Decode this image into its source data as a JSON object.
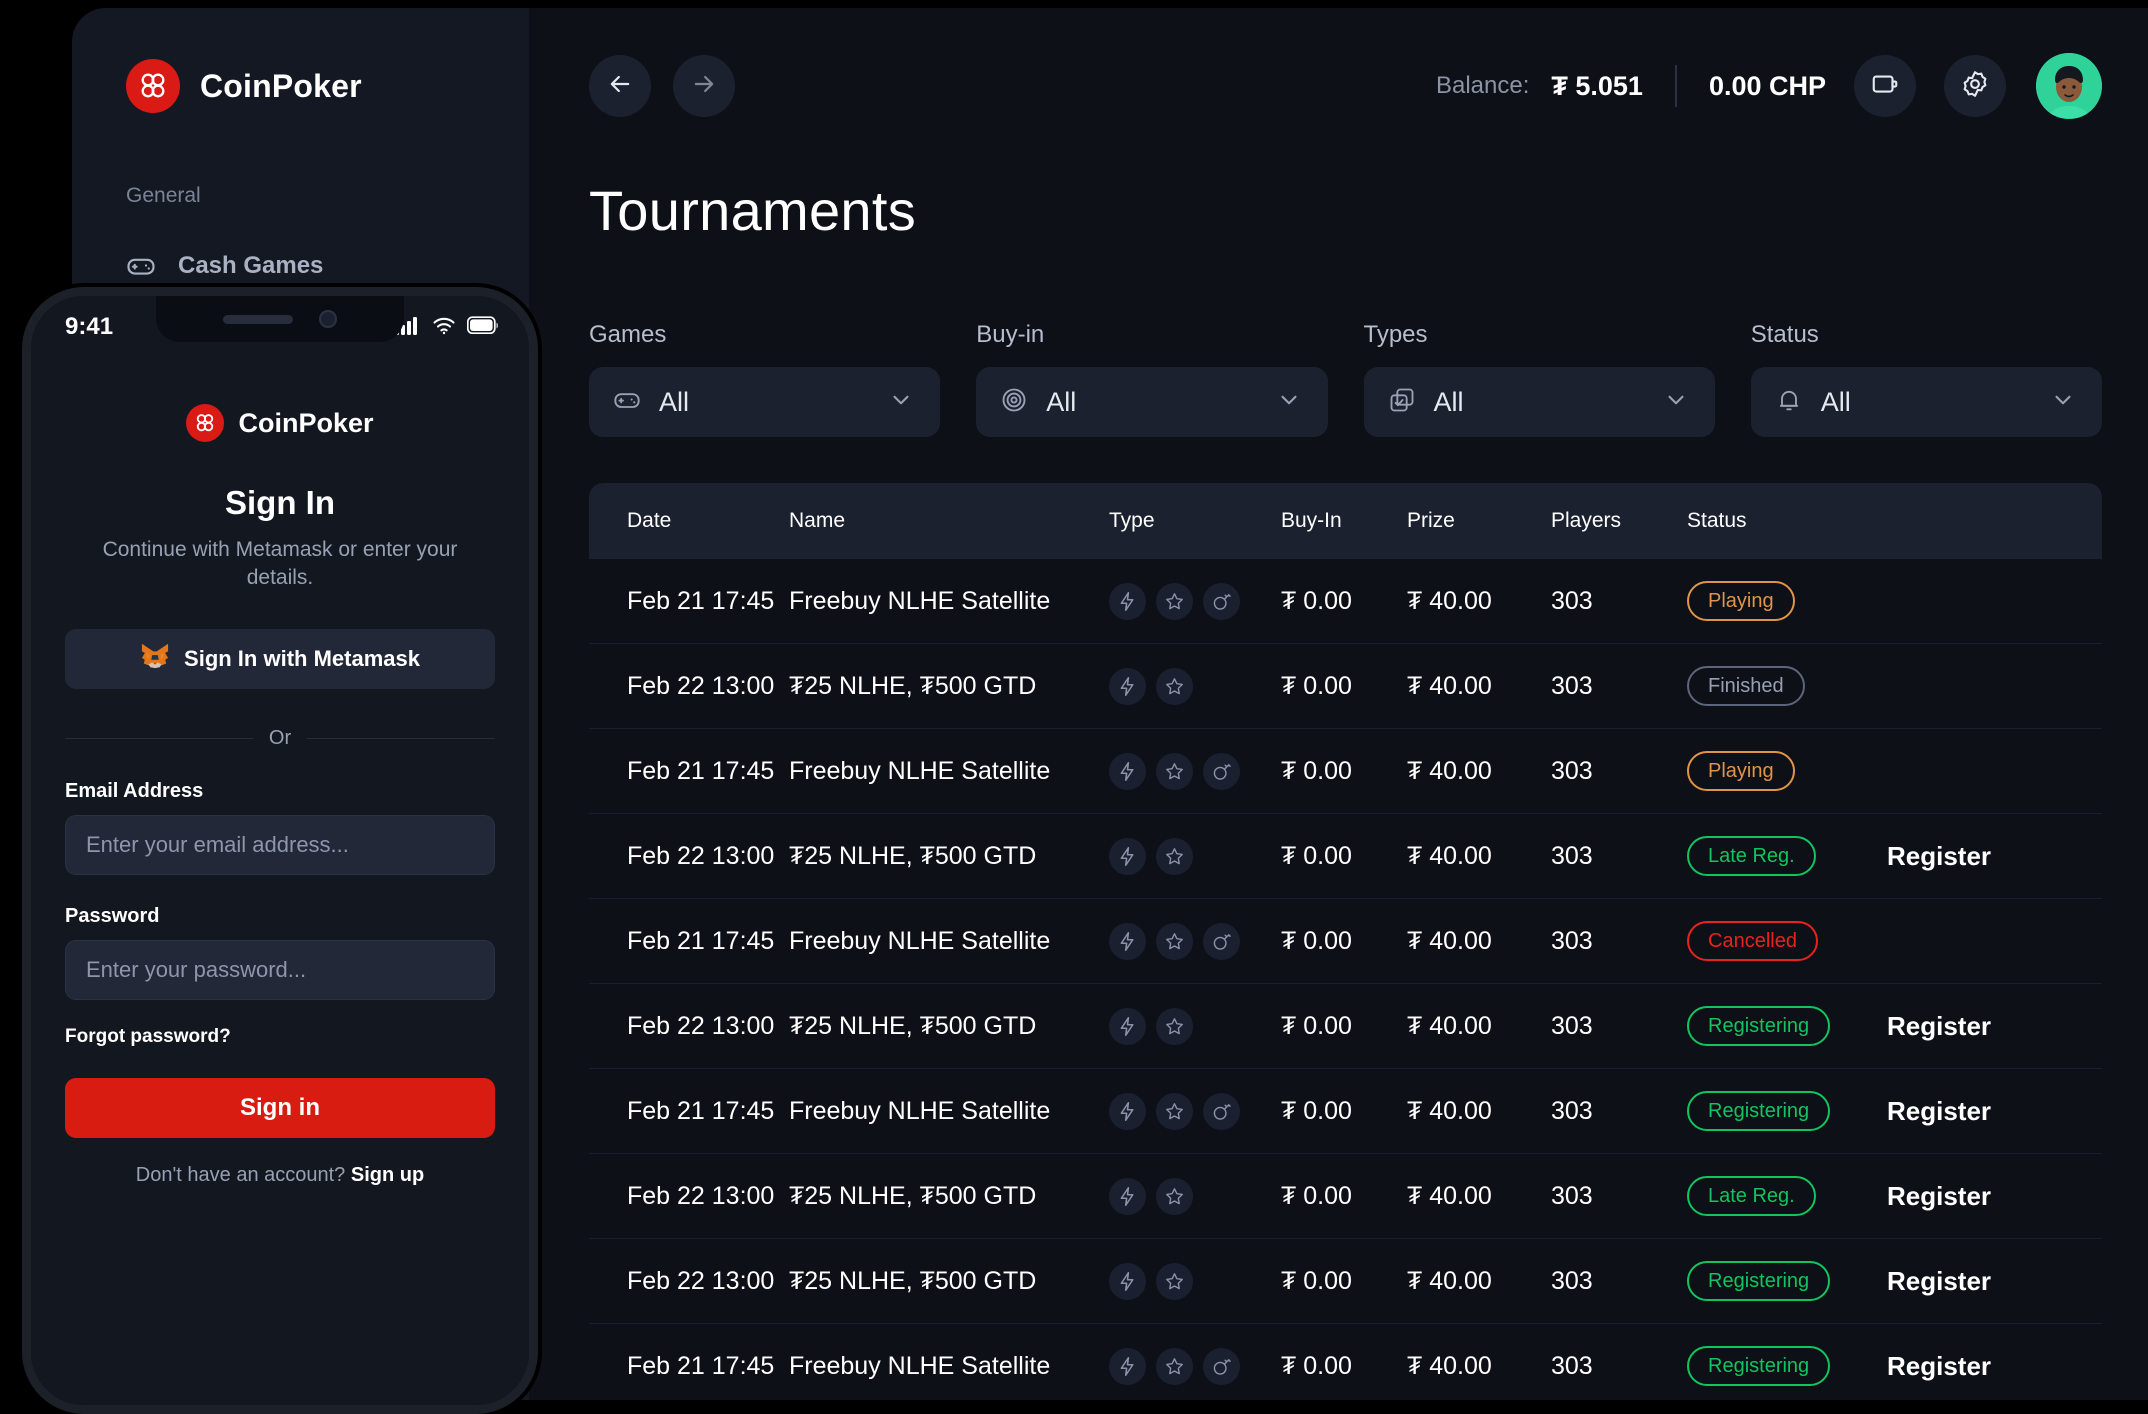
{
  "desktop": {
    "brand": {
      "name": "CoinPoker",
      "logo_icon": "coinpoker-logo-icon",
      "accent": "#da1b15"
    },
    "sidebar": {
      "section_label": "General",
      "items": [
        {
          "label": "Cash Games",
          "icon": "gamepad-icon"
        }
      ]
    },
    "topbar": {
      "back_icon": "arrow-left-icon",
      "forward_icon": "arrow-right-icon",
      "balance_label": "Balance:",
      "balance_value": "₮ 5.051",
      "chp_value": "0.00 CHP",
      "wallet_icon": "wallet-icon",
      "settings_icon": "gear-icon",
      "avatar_icon": "avatar"
    },
    "page_title": "Tournaments",
    "filters": [
      {
        "label": "Games",
        "value": "All",
        "icon": "gamepad-icon",
        "chevron": "chevron-down-icon"
      },
      {
        "label": "Buy-in",
        "value": "All",
        "icon": "chip-icon",
        "chevron": "chevron-down-icon"
      },
      {
        "label": "Types",
        "value": "All",
        "icon": "copy-check-icon",
        "chevron": "chevron-down-icon"
      },
      {
        "label": "Status",
        "value": "All",
        "icon": "bell-icon",
        "chevron": "chevron-down-icon"
      }
    ],
    "table": {
      "columns": [
        "Date",
        "Name",
        "Type",
        "Buy-In",
        "Prize",
        "Players",
        "Status",
        ""
      ],
      "rows": [
        {
          "date": "Feb 21 17:45",
          "name": "Freebuy NLHE Satellite",
          "types": [
            "bolt-icon",
            "star-icon",
            "bomb-icon"
          ],
          "buyin": "₮ 0.00",
          "prize": "₮ 40.00",
          "players": "303",
          "status": "Playing",
          "status_kind": "playing",
          "action": ""
        },
        {
          "date": "Feb 22 13:00",
          "name": "₮25 NLHE, ₮500 GTD",
          "types": [
            "bolt-icon",
            "star-icon"
          ],
          "buyin": "₮ 0.00",
          "prize": "₮ 40.00",
          "players": "303",
          "status": "Finished",
          "status_kind": "finished",
          "action": ""
        },
        {
          "date": "Feb 21 17:45",
          "name": "Freebuy NLHE Satellite",
          "types": [
            "bolt-icon",
            "star-icon",
            "bomb-icon"
          ],
          "buyin": "₮ 0.00",
          "prize": "₮ 40.00",
          "players": "303",
          "status": "Playing",
          "status_kind": "playing",
          "action": ""
        },
        {
          "date": "Feb 22 13:00",
          "name": "₮25 NLHE, ₮500 GTD",
          "types": [
            "bolt-icon",
            "star-icon"
          ],
          "buyin": "₮ 0.00",
          "prize": "₮ 40.00",
          "players": "303",
          "status": "Late Reg.",
          "status_kind": "latereg",
          "action": "Register"
        },
        {
          "date": "Feb 21 17:45",
          "name": "Freebuy NLHE Satellite",
          "types": [
            "bolt-icon",
            "star-icon",
            "bomb-icon"
          ],
          "buyin": "₮ 0.00",
          "prize": "₮ 40.00",
          "players": "303",
          "status": "Cancelled",
          "status_kind": "cancelled",
          "action": ""
        },
        {
          "date": "Feb 22 13:00",
          "name": "₮25 NLHE, ₮500 GTD",
          "types": [
            "bolt-icon",
            "star-icon"
          ],
          "buyin": "₮ 0.00",
          "prize": "₮ 40.00",
          "players": "303",
          "status": "Registering",
          "status_kind": "registering",
          "action": "Register"
        },
        {
          "date": "Feb 21 17:45",
          "name": "Freebuy NLHE Satellite",
          "types": [
            "bolt-icon",
            "star-icon",
            "bomb-icon"
          ],
          "buyin": "₮ 0.00",
          "prize": "₮ 40.00",
          "players": "303",
          "status": "Registering",
          "status_kind": "registering",
          "action": "Register"
        },
        {
          "date": "Feb 22 13:00",
          "name": "₮25 NLHE, ₮500 GTD",
          "types": [
            "bolt-icon",
            "star-icon"
          ],
          "buyin": "₮ 0.00",
          "prize": "₮ 40.00",
          "players": "303",
          "status": "Late Reg.",
          "status_kind": "latereg",
          "action": "Register"
        },
        {
          "date": "Feb 22 13:00",
          "name": "₮25 NLHE, ₮500 GTD",
          "types": [
            "bolt-icon",
            "star-icon"
          ],
          "buyin": "₮ 0.00",
          "prize": "₮ 40.00",
          "players": "303",
          "status": "Registering",
          "status_kind": "registering",
          "action": "Register"
        },
        {
          "date": "Feb 21 17:45",
          "name": "Freebuy NLHE Satellite",
          "types": [
            "bolt-icon",
            "star-icon",
            "bomb-icon"
          ],
          "buyin": "₮ 0.00",
          "prize": "₮ 40.00",
          "players": "303",
          "status": "Registering",
          "status_kind": "registering",
          "action": "Register"
        }
      ]
    }
  },
  "phone": {
    "status_bar": {
      "time": "9:41",
      "cellular_icon": "signal-bars-icon",
      "wifi_icon": "wifi-icon",
      "battery_icon": "battery-icon"
    },
    "brand": {
      "name": "CoinPoker",
      "logo_icon": "coinpoker-logo-icon"
    },
    "title": "Sign In",
    "subtitle": "Continue with Metamask or enter your details.",
    "metamask_button": {
      "label": "Sign In with Metamask",
      "icon": "metamask-fox-icon"
    },
    "divider_text": "Or",
    "email": {
      "label": "Email Address",
      "placeholder": "Enter your email address...",
      "value": ""
    },
    "password": {
      "label": "Password",
      "placeholder": "Enter your password...",
      "value": ""
    },
    "forgot_password": "Forgot password?",
    "signin_button": "Sign in",
    "signup_prompt": "Don't have an account?",
    "signup_link": "Sign up",
    "accent": "#d81c11"
  }
}
